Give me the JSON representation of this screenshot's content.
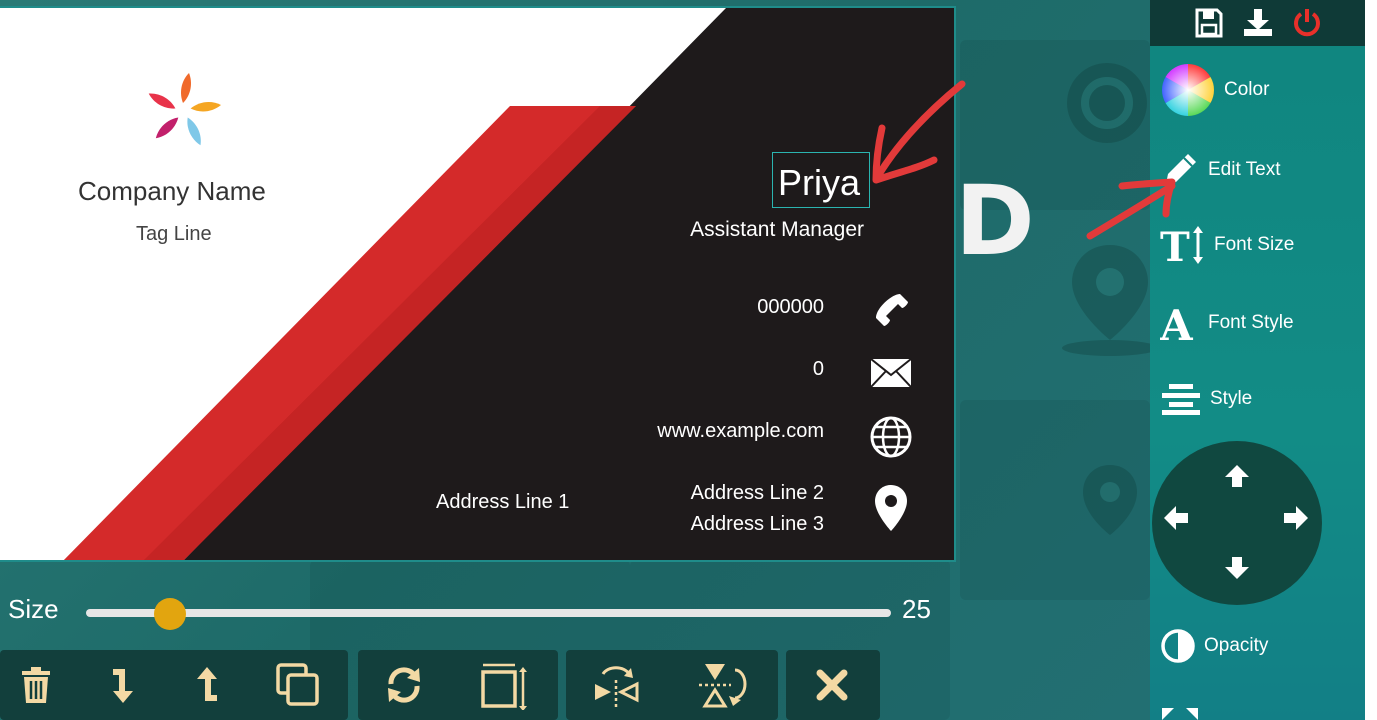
{
  "card": {
    "company_name": "Company Name",
    "tag_line": "Tag Line",
    "person_name": "Priya",
    "job_title": "Assistant Manager",
    "phone": "000000",
    "email": "0",
    "website": "www.example.com",
    "address_line_1": "Address Line 1",
    "address_line_2": "Address Line 2",
    "address_line_3": "Address Line 3"
  },
  "colors": {
    "card_dark": "#1e1a1b",
    "card_red": "#d42a2a",
    "panel": "#10857f",
    "slider_thumb": "#e2a50f",
    "annotation": "#e23a3a"
  },
  "size_control": {
    "label": "Size",
    "value": "25",
    "level_fraction": 0.1
  },
  "toolbar": {
    "icons": [
      "trash-icon",
      "send-backward-icon",
      "bring-forward-icon",
      "duplicate-icon",
      "rotate-icon",
      "resize-icon",
      "flip-horizontal-icon",
      "flip-vertical-icon",
      "close-icon"
    ]
  },
  "panel": {
    "top_icons": [
      "save-icon",
      "download-icon",
      "power-icon"
    ],
    "color_label": "Color",
    "edit_text_label": "Edit Text",
    "font_size_label": "Font Size",
    "font_style_label": "Font Style",
    "style_label": "Style",
    "opacity_label": "Opacity"
  },
  "background": {
    "letter": "D"
  }
}
